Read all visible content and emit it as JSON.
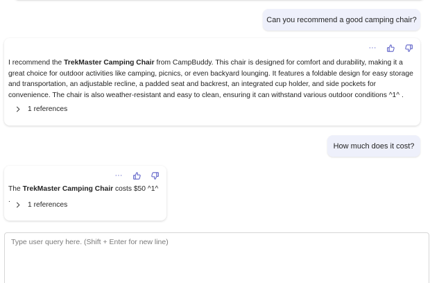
{
  "conversation": {
    "user_message_1": "Can you recommend a good camping chair?",
    "bot_message_1": {
      "prefix": "I recommend the ",
      "bold": "TrekMaster Camping Chair",
      "suffix": " from CampBuddy. This chair is designed for comfort and durability, making it a great choice for outdoor activities like camping, picnics, or even backyard lounging. It features a foldable design for easy storage and transportation, an adjustable recline, a padded seat and backrest, an integrated cup holder, and side pockets for convenience. The chair is also weather-resistant and easy to clean, ensuring it can withstand various outdoor conditions ^1^ .",
      "references_label": "1 references"
    },
    "user_message_2": "How much does it cost?",
    "bot_message_2": {
      "prefix": "The ",
      "bold": "TrekMaster Camping Chair",
      "suffix": " costs $50 ^1^ .",
      "references_label": "1 references"
    }
  },
  "actions": {
    "more": "···",
    "icons": [
      "more-options-icon",
      "thumbs-up-icon",
      "thumbs-down-icon",
      "chevron-right-icon"
    ]
  },
  "composer": {
    "placeholder": "Type user query here. (Shift + Enter for new line)",
    "value": ""
  },
  "colors": {
    "accent": "#5b5fc7",
    "user_bubble": "#eef0fb",
    "text": "#242424",
    "placeholder": "#7a7a7a"
  }
}
